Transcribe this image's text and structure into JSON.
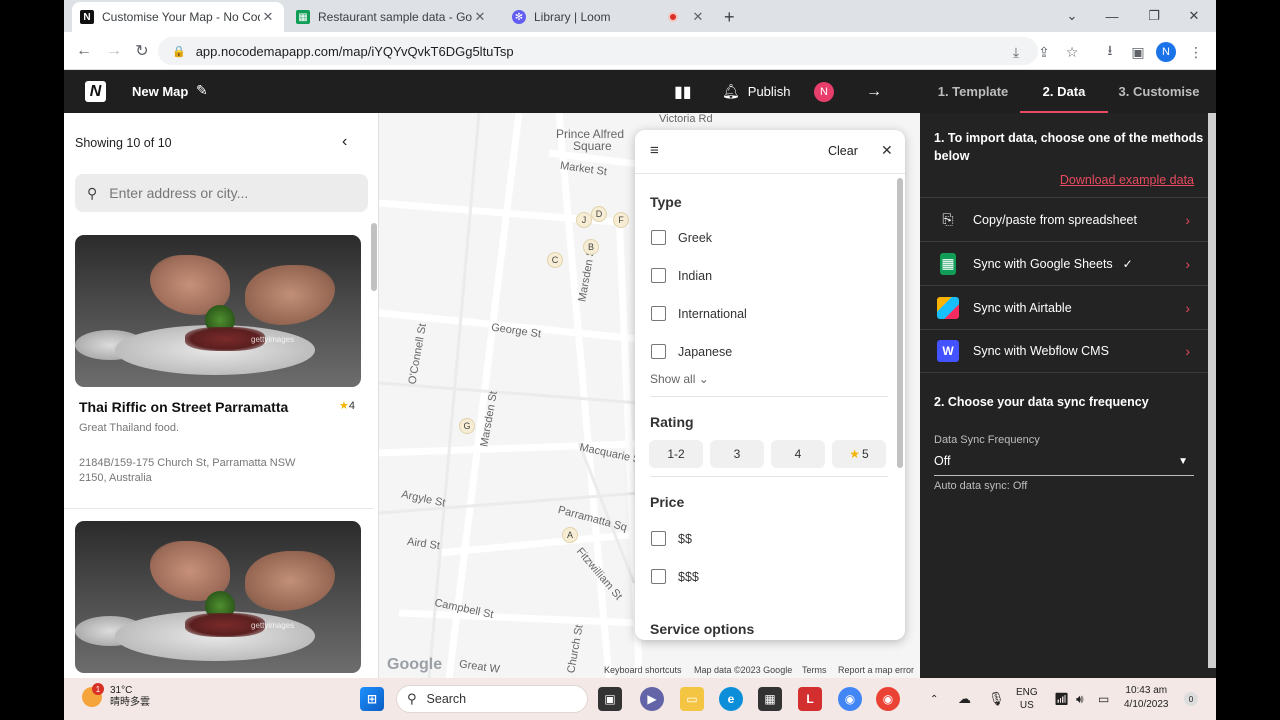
{
  "browser": {
    "tabs": [
      {
        "title": "Customise Your Map - No Code",
        "favicon": "N",
        "color": "#111111"
      },
      {
        "title": "Restaurant sample data - Googl",
        "favicon": "sheets",
        "color": "#0f9d58"
      },
      {
        "title": "Library | Loom",
        "favicon": "loom",
        "color": "#625df5"
      }
    ],
    "url": "app.nocodemapapp.com/map/iYQYvQvkT6DGg5ltuTsp",
    "profile_initial": "N"
  },
  "app": {
    "logo": "N",
    "map_title": "New Map",
    "publish_label": "Publish",
    "user_initial": "N",
    "steps": [
      "1. Template",
      "2. Data",
      "3. Customise"
    ],
    "active_step": 1
  },
  "left_panel": {
    "showing": "Showing 10 of 10",
    "search_placeholder": "Enter address or city...",
    "cards": [
      {
        "title": "Thai Riffic on Street Parramatta",
        "rating": "4",
        "description": "Great Thailand food.",
        "address": "2184B/159-175 Church St, Parramatta NSW 2150, Australia",
        "watermark": "gettyimages"
      },
      {
        "watermark": "gettyimages"
      }
    ]
  },
  "map": {
    "labels": [
      "Prince Alfred",
      "Square",
      "Market St",
      "Victoria Rd",
      "George St",
      "O'Connell St",
      "Marsden St",
      "Marsden St",
      "Macquarie St",
      "Argyle St",
      "Parramatta Sq",
      "Aird St",
      "Fitzwilliam St",
      "Campbell St",
      "Church St",
      "Great W"
    ],
    "pins": [
      "J",
      "D",
      "F",
      "B",
      "C",
      "G",
      "A"
    ],
    "footer": [
      "Keyboard shortcuts",
      "Map data ©2023 Google",
      "Terms",
      "Report a map error"
    ],
    "google": "Google"
  },
  "filter": {
    "clear_label": "Clear",
    "type_heading": "Type",
    "types": [
      "Greek",
      "Indian",
      "International",
      "Japanese"
    ],
    "show_all": "Show all",
    "rating_heading": "Rating",
    "ratings": [
      "1-2",
      "3",
      "4",
      "5"
    ],
    "price_heading": "Price",
    "prices": [
      "$$",
      "$$$"
    ],
    "service_heading": "Service options"
  },
  "right_panel": {
    "step1": "1. To import data, choose one of the methods below",
    "download_link": "Download example data",
    "methods": [
      {
        "label": "Copy/paste from spreadsheet",
        "icon": "copy-icon"
      },
      {
        "label": "Sync with Google Sheets",
        "icon": "google-sheets-icon",
        "checked": true
      },
      {
        "label": "Sync with Airtable",
        "icon": "airtable-icon"
      },
      {
        "label": "Sync with Webflow CMS",
        "icon": "webflow-icon"
      }
    ],
    "step2": "2. Choose your data sync frequency",
    "freq_label": "Data Sync Frequency",
    "freq_value": "Off",
    "auto_sync": "Auto data sync: Off"
  },
  "taskbar": {
    "temperature": "31°C",
    "weather_text": "晴時多雲",
    "weather_badge": "1",
    "search_label": "Search",
    "lang": "ENG",
    "region": "US",
    "time": "10:43 am",
    "date": "4/10/2023",
    "notification_count": "0"
  },
  "colors": {
    "accent": "#e84a5f",
    "header_bg": "#1f1f1f",
    "panel_bg": "#232323"
  }
}
